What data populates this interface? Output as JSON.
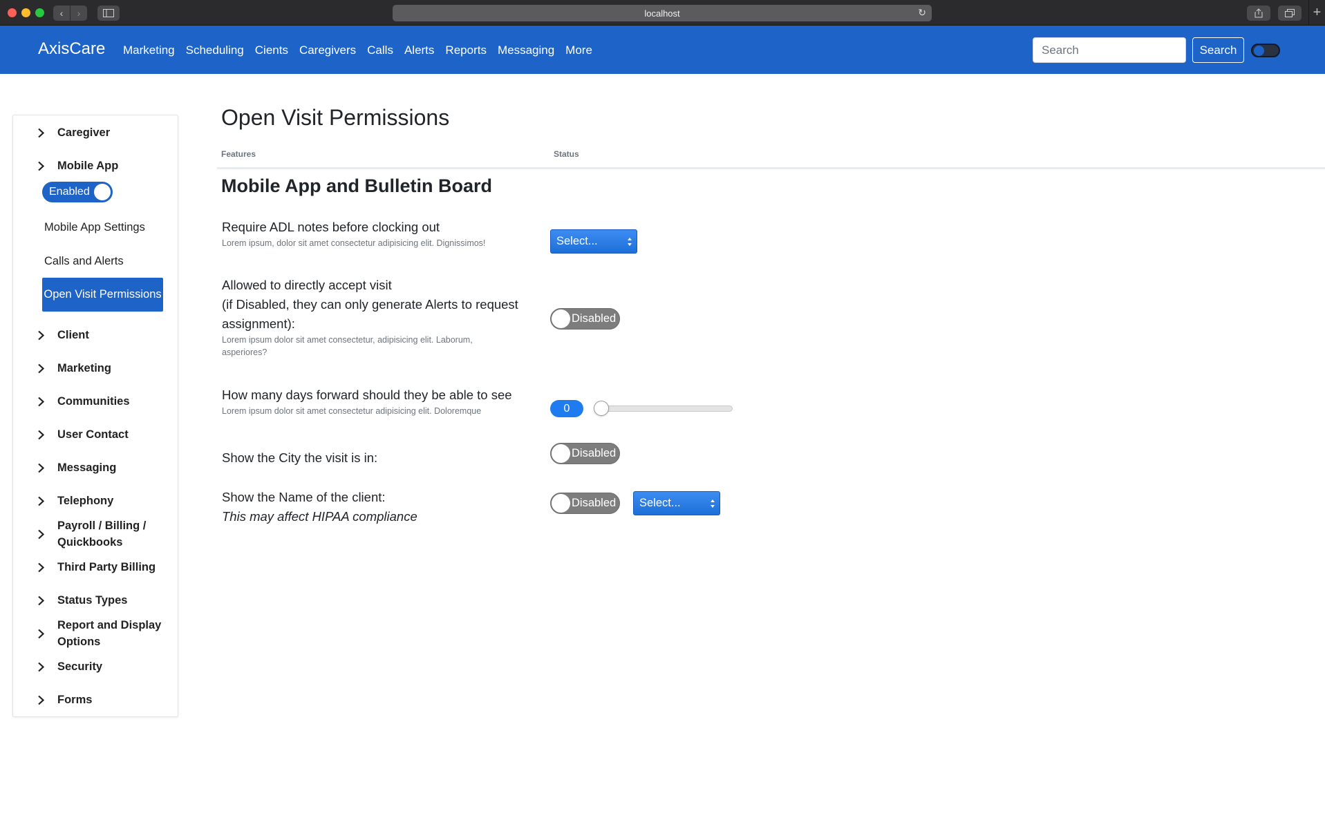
{
  "browser": {
    "url": "localhost",
    "icons": [
      "back-icon",
      "forward-icon",
      "sidebar-icon",
      "reload-icon",
      "share-icon",
      "tabs-icon",
      "new-tab-icon"
    ]
  },
  "navbar": {
    "brand": "AxisCare",
    "links": [
      "Marketing",
      "Scheduling",
      "Cients",
      "Caregivers",
      "Calls",
      "Alerts",
      "Reports",
      "Messaging",
      "More"
    ],
    "search_placeholder": "Search",
    "search_button": "Search",
    "accent_color": "#1e63c8"
  },
  "sidebar": {
    "items": [
      {
        "label": "Caregiver"
      },
      {
        "label": "Mobile App"
      },
      {
        "label": "Client"
      },
      {
        "label": "Marketing"
      },
      {
        "label": "Communities"
      },
      {
        "label": "User Contact"
      },
      {
        "label": "Messaging"
      },
      {
        "label": "Telephony"
      },
      {
        "label": "Payroll / Billing /"
      },
      {
        "label": "Quickbooks"
      },
      {
        "label": "Third Party Billing"
      },
      {
        "label": "Status Types"
      },
      {
        "label": "Report and Display"
      },
      {
        "label": "Options"
      },
      {
        "label": "Security"
      },
      {
        "label": "Forms"
      }
    ],
    "mobile_app_toggle": "Enabled",
    "sub_items": [
      "Mobile App Settings",
      "Calls and Alerts",
      "Open Visit Permissions"
    ]
  },
  "main": {
    "title": "Open Visit Permissions",
    "columns": {
      "features": "Features",
      "status": "Status"
    },
    "section_title": "Mobile App and Bulletin Board",
    "features": [
      {
        "label": "Require ADL notes before clocking out",
        "desc": "Lorem ipsum, dolor sit amet consectetur adipisicing elit. Dignissimos!",
        "select": "Select..."
      },
      {
        "label_lines": [
          "Allowed to directly accept visit",
          "(if Disabled, they can only generate Alerts to request",
          "assignment):"
        ],
        "desc_lines": [
          "Lorem ipsum dolor sit amet consectetur, adipisicing elit. Laborum,",
          "asperiores?"
        ],
        "toggle": "Disabled"
      },
      {
        "label": "How many days forward should they be able to see",
        "desc": "Lorem ipsum dolor sit amet consectetur adipisicing elit. Doloremque",
        "value": "0"
      },
      {
        "label": "Show the City the visit is in:",
        "toggle": "Disabled"
      },
      {
        "label": "Show the Name of the client:",
        "note": "This may affect HIPAA compliance",
        "toggle": "Disabled",
        "select": "Select..."
      }
    ]
  }
}
